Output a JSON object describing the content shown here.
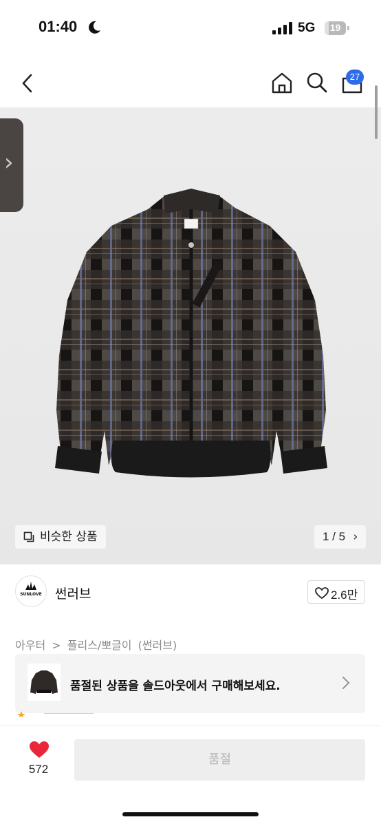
{
  "status_bar": {
    "time": "01:40",
    "network": "5G",
    "battery": "19",
    "battery_percent": 19,
    "icons": [
      "moon-icon",
      "signal-icon",
      "battery-icon"
    ]
  },
  "nav": {
    "icons": [
      "back-chevron-icon",
      "home-icon",
      "search-icon",
      "cart-icon"
    ],
    "cart_count": "27"
  },
  "gallery": {
    "similar_label": "비슷한 상품",
    "counter": "1 / 5",
    "counter_arrow": "›",
    "side_tab_arrow": "›",
    "product_image": "plaid-zip-jacket",
    "logo_text": "SUNLOVE"
  },
  "seller": {
    "name": "썬러브",
    "logo_text": "SUNLOVE",
    "likes": "2.6만"
  },
  "breadcrumb": [
    "아우터",
    ">",
    "플리스/뽀글이",
    "(썬러브)"
  ],
  "soldout_banner": {
    "text": "품절된 상품을 솔드아웃에서 구매해보세요."
  },
  "bottom_bar": {
    "wish_count": "572",
    "buy_label": "품절"
  },
  "colors": {
    "accent_blue": "#2e6be6",
    "heart_red": "#e8283a",
    "disabled_gray": "#eeeeee"
  }
}
